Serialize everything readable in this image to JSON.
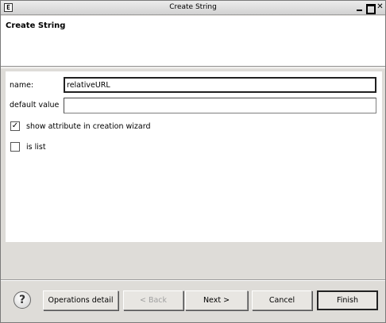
{
  "window": {
    "title": "Create String",
    "app_icon": "E",
    "controls": [
      "minimize",
      "maximize",
      "close"
    ]
  },
  "banner": {
    "title": "Create String"
  },
  "form": {
    "name_label": "name:",
    "name_value": "relativeURL",
    "default_label": "default value",
    "default_value": "",
    "show_attr_label": "show attribute in creation wizard",
    "show_attr_checked": true,
    "is_list_label": "is list",
    "is_list_checked": false
  },
  "buttons": {
    "help": "?",
    "operations_detail": "Operations detail",
    "back": "< Back",
    "next": "Next >",
    "cancel": "Cancel",
    "finish": "Finish"
  },
  "icons": {
    "app": "eclipse-icon",
    "help": "help-icon",
    "check": "check-icon"
  }
}
